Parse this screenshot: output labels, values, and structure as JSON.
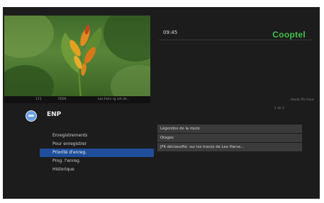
{
  "clock": "09:45",
  "brand": "Cooptel",
  "preview_bar": {
    "channel_number": "111",
    "time": "0000",
    "program": "Les Fairs rg set de..."
  },
  "sub_info": "Heute IPs Hour",
  "page_info": "1 de 2",
  "section": {
    "icon": "circle-record-icon",
    "title": "ENP"
  },
  "menu": [
    {
      "label": "Enregistrements",
      "selected": false
    },
    {
      "label": "Pour enregistrer",
      "selected": false
    },
    {
      "label": "Priorité d'enreg.",
      "selected": true
    },
    {
      "label": "Prog. l'enreg.",
      "selected": false
    },
    {
      "label": "Historique",
      "selected": false
    }
  ],
  "recordings": [
    "Légendes de la route",
    "Otages",
    "JFK déclassifié: sur les traces de Lee Harve..."
  ],
  "colors": {
    "background": "#1c1c1c",
    "selection": "#1f4e9a",
    "brand": "#44c24a"
  }
}
